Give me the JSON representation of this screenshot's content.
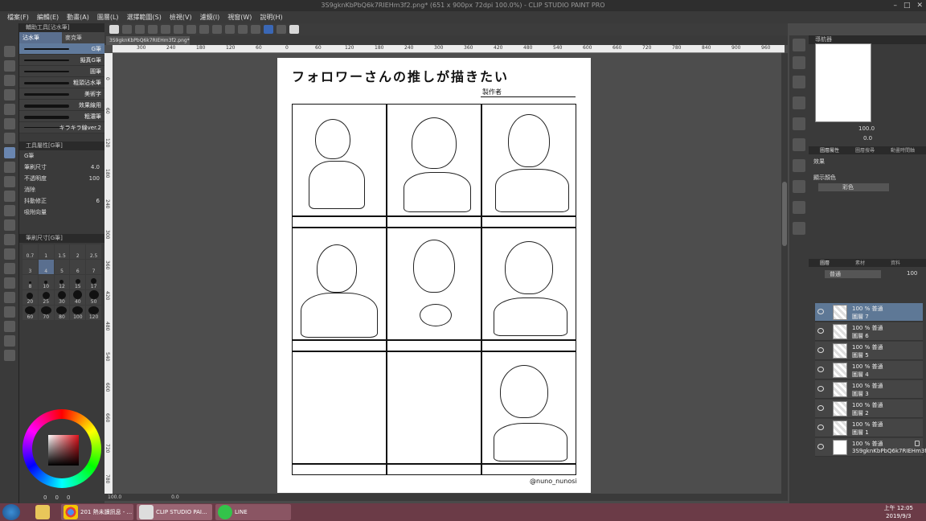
{
  "window": {
    "title": "3S9gknKbPbQ6k7RIEHm3f2.png* (651 x 900px 72dpi 100.0%) - CLIP STUDIO PAINT PRO"
  },
  "menu": [
    "檔案(F)",
    "編輯(E)",
    "動畫(A)",
    "圖層(L)",
    "選擇範圍(S)",
    "檢視(V)",
    "濾鏡(I)",
    "視窗(W)",
    "說明(H)"
  ],
  "left_panel": {
    "header": "輔助工具[沾水筆]",
    "tabs": [
      "沾水筆",
      "麥克筆"
    ],
    "brushes": [
      "G筆",
      "擬真G筆",
      "圓筆",
      "粗頭沾水筆",
      "美術字",
      "效果線用",
      "粗濃筆",
      "キラキラ線ver.2"
    ],
    "tool_prop_header": "工具屬性[G筆]",
    "tool_prop_name": "G筆",
    "props": [
      {
        "label": "筆刷尺寸",
        "value": "4.0"
      },
      {
        "label": "不透明度",
        "value": "100"
      },
      {
        "label": "消除",
        "value": ""
      },
      {
        "label": "抖動修正",
        "value": "6"
      },
      {
        "label": "吸附向量",
        "value": ""
      }
    ],
    "size_header": "筆刷尺寸[G筆]",
    "sizes": [
      "0.7",
      "1",
      "1.5",
      "2",
      "2.5",
      "3",
      "4",
      "5",
      "6",
      "7",
      "8",
      "10",
      "12",
      "15",
      "17",
      "20",
      "25",
      "30",
      "40",
      "50",
      "60",
      "70",
      "80",
      "100",
      "120"
    ]
  },
  "tab": {
    "name": "3S9gknKbPbQ6k7RIEHm3f2.png*"
  },
  "rulers": {
    "top": [
      "300",
      "240",
      "180",
      "120",
      "60",
      "0",
      "60",
      "120",
      "180",
      "240",
      "300",
      "360",
      "420",
      "480",
      "540",
      "600",
      "660",
      "720",
      "780",
      "840",
      "900",
      "960",
      "1020"
    ],
    "left": [
      "0",
      "60",
      "120",
      "180",
      "240",
      "300",
      "360",
      "420",
      "480",
      "540",
      "600",
      "660",
      "720",
      "780"
    ]
  },
  "paper": {
    "title": "フォロワーさんの推しが描きたい",
    "credit": "製作者",
    "footer": "@nuno_nunosi"
  },
  "status": {
    "zoom": "100.0",
    "coords": "0.0"
  },
  "right_panel": {
    "nav_header": "導航器",
    "nav_zoom": "100.0",
    "nav_angle": "0.0",
    "prop_tabs": [
      "圖層屬性",
      "圖層搜尋",
      "動畫時間軸"
    ],
    "effect_label": "效果",
    "display_color_label": "顯示顏色",
    "display_color_value": "彩色",
    "layer_tabs": [
      "圖層",
      "素材",
      "資料"
    ],
    "blend_mode": "普通",
    "opacity": "100",
    "layers": [
      {
        "mode": "100 % 普通",
        "name": "圖層 7",
        "selected": true
      },
      {
        "mode": "100 % 普通",
        "name": "圖層 6",
        "selected": false
      },
      {
        "mode": "100 % 普通",
        "name": "圖層 5",
        "selected": false
      },
      {
        "mode": "100 % 普通",
        "name": "圖層 4",
        "selected": false
      },
      {
        "mode": "100 % 普通",
        "name": "圖層 3",
        "selected": false
      },
      {
        "mode": "100 % 普通",
        "name": "圖層 2",
        "selected": false
      },
      {
        "mode": "100 % 普通",
        "name": "圖層 1",
        "selected": false
      },
      {
        "mode": "100 % 普通",
        "name": "3S9gknKbPbQ6k7RIEHm3f2",
        "selected": false
      }
    ]
  },
  "color_bottom": {
    "values": [
      "0",
      "0",
      "0"
    ]
  },
  "taskbar": {
    "apps": [
      {
        "label": "201 熱未讀訊息 - ..."
      },
      {
        "label": "CLIP STUDIO PAI..."
      },
      {
        "label": "LINE"
      }
    ],
    "time": "上午 12:05",
    "date": "2019/9/3"
  },
  "colors": {
    "accent": "#5e7896",
    "taskbar": "#6b3b47",
    "bg": "#4a4a4a"
  }
}
